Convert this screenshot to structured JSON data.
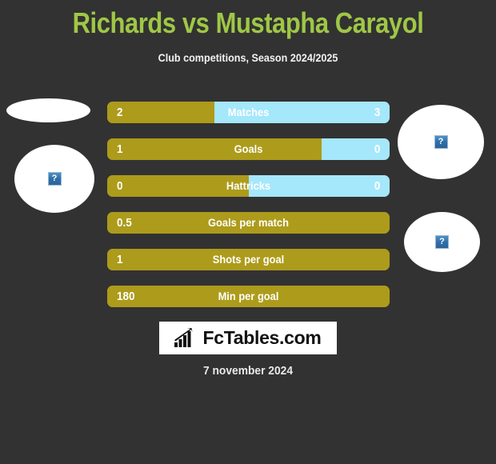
{
  "header": {
    "title": "Richards vs Mustapha Carayol",
    "subtitle": "Club competitions, Season 2024/2025",
    "title_color": "#9FC746",
    "background_color": "#323232"
  },
  "photos": {
    "left_top": {
      "alt_icon": "broken-image-icon",
      "glyph": "?"
    },
    "left_bottom": {
      "alt_icon": "broken-image-icon",
      "glyph": "?"
    },
    "right_top": {
      "alt_icon": "broken-image-icon",
      "glyph": "?"
    },
    "right_bottom": {
      "alt_icon": "broken-image-icon",
      "glyph": "?"
    }
  },
  "chart_data": {
    "type": "bar",
    "title": "Richards vs Mustapha Carayol",
    "subtitle": "Club competitions, Season 2024/2025",
    "orientation": "horizontal-diverging",
    "categories": [
      "Matches",
      "Goals",
      "Hattricks",
      "Goals per match",
      "Shots per goal",
      "Min per goal"
    ],
    "series": [
      {
        "name": "Richards",
        "color": "#AD9B1B",
        "values": [
          "2",
          "1",
          "0",
          "0.5",
          "1",
          "180"
        ]
      },
      {
        "name": "Mustapha Carayol",
        "color": "#A5E7FB",
        "values": [
          "3",
          "0",
          "0",
          "",
          "",
          ""
        ]
      }
    ],
    "rows": [
      {
        "label": "Matches",
        "home_value": "2",
        "away_value": "3",
        "home_pct": 38,
        "away_pct": 62,
        "has_away": true
      },
      {
        "label": "Goals",
        "home_value": "1",
        "away_value": "0",
        "home_pct": 76,
        "away_pct": 24,
        "has_away": true
      },
      {
        "label": "Hattricks",
        "home_value": "0",
        "away_value": "0",
        "home_pct": 50,
        "away_pct": 50,
        "has_away": true
      },
      {
        "label": "Goals per match",
        "home_value": "0.5",
        "away_value": "",
        "home_pct": 100,
        "away_pct": 0,
        "has_away": false
      },
      {
        "label": "Shots per goal",
        "home_value": "1",
        "away_value": "",
        "home_pct": 100,
        "away_pct": 0,
        "has_away": false
      },
      {
        "label": "Min per goal",
        "home_value": "180",
        "away_value": "",
        "home_pct": 100,
        "away_pct": 0,
        "has_away": false
      }
    ]
  },
  "footer": {
    "logo_text": "FcTables.com",
    "logo_icon": "bar-chart-arrow-icon",
    "date": "7 november 2024"
  }
}
